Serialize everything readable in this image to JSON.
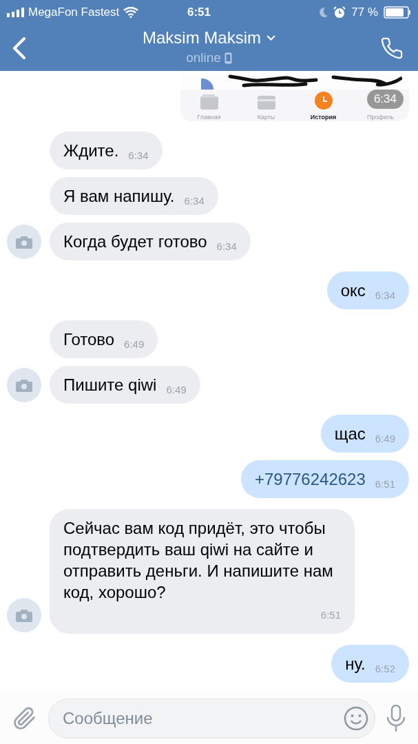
{
  "status_bar": {
    "carrier": "MegaFon Fastest",
    "time": "6:51",
    "battery": "77 %"
  },
  "header": {
    "title": "Maksim Maksim",
    "status": "online"
  },
  "attachment": {
    "tabs": [
      {
        "label": "Главная",
        "selected": false
      },
      {
        "label": "Карты",
        "selected": false
      },
      {
        "label": "История",
        "selected": true
      },
      {
        "label": "Профиль",
        "selected": false
      }
    ],
    "time": "6:34"
  },
  "messages": [
    {
      "kind": "incoming",
      "text": "Ждите.",
      "time": "6:34",
      "avatar": false,
      "link": false
    },
    {
      "kind": "incoming",
      "text": "Я вам напишу.",
      "time": "6:34",
      "avatar": false,
      "link": false
    },
    {
      "kind": "incoming",
      "text": "Когда будет готово",
      "time": "6:34",
      "avatar": true,
      "link": false
    },
    {
      "kind": "outgoing",
      "text": "окс",
      "time": "6:34",
      "link": false
    },
    {
      "kind": "incoming",
      "text": "Готово",
      "time": "6:49",
      "avatar": false,
      "link": false
    },
    {
      "kind": "incoming",
      "text": "Пишите qiwi",
      "time": "6:49",
      "avatar": true,
      "link": false
    },
    {
      "kind": "outgoing",
      "text": "щас",
      "time": "6:49",
      "link": false
    },
    {
      "kind": "outgoing",
      "text": "+79776242623",
      "time": "6:51",
      "link": true
    },
    {
      "kind": "incoming",
      "text": "Сейчас вам код придёт, это чтобы подтвердить ваш qiwi на сайте и отправить деньги. И напишите нам код, хорошо?",
      "time": "6:51",
      "avatar": true,
      "link": false
    },
    {
      "kind": "outgoing",
      "text": "ну.",
      "time": "6:52",
      "link": false
    }
  ],
  "composer": {
    "placeholder": "Сообщение"
  }
}
